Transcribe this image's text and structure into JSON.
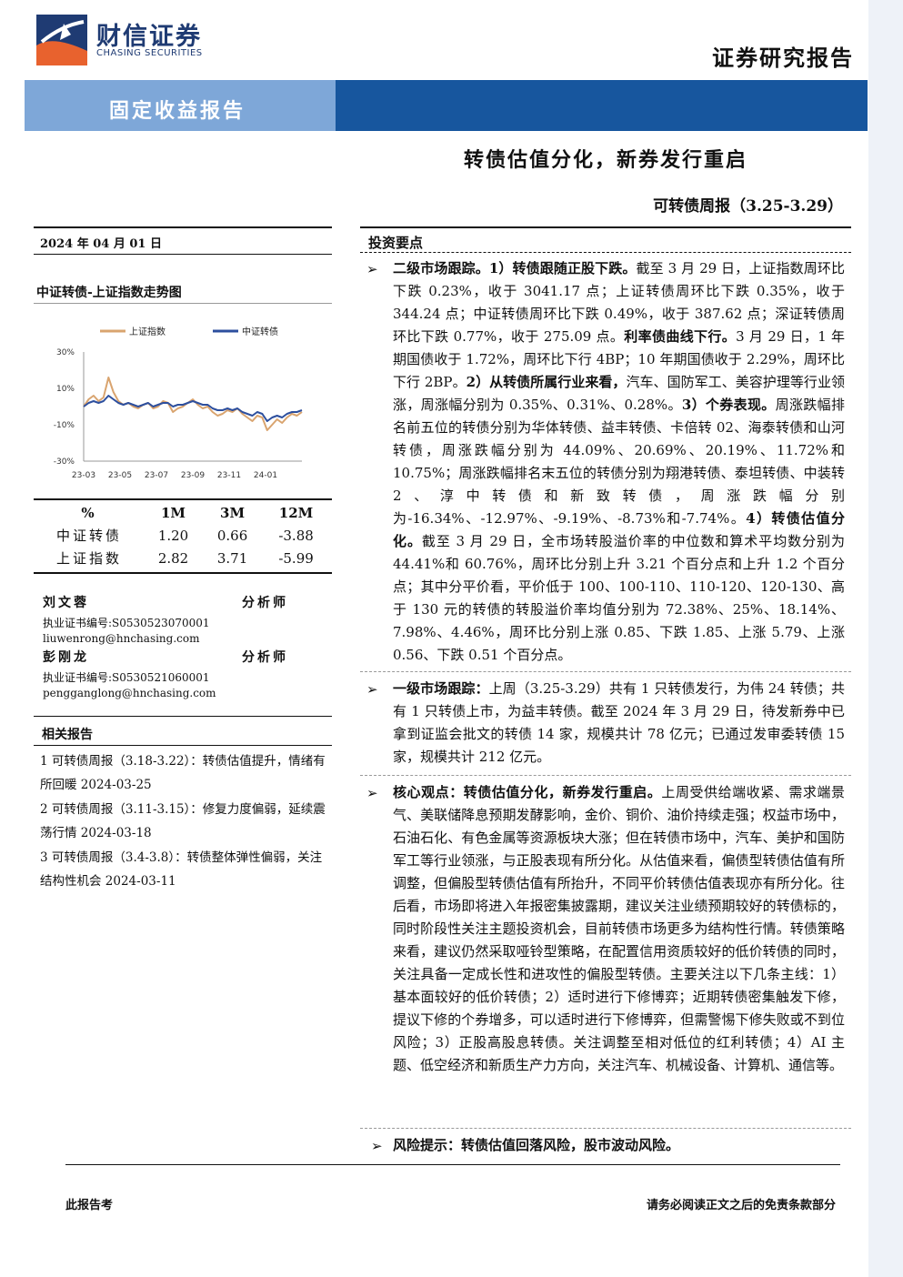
{
  "header": {
    "brand_cn": "财信证券",
    "brand_en": "CHASING SECURITIES",
    "report_type": "证券研究报告",
    "category": "固定收益报告",
    "title": "转债估值分化，新券发行重启",
    "subtitle": "可转债周报（3.25-3.29）"
  },
  "left": {
    "date": "2024 年 04 月 01 日",
    "chart_title": "中证转债-上证指数走势图",
    "performance": {
      "headers": [
        "%",
        "1M",
        "3M",
        "12M"
      ],
      "rows": [
        {
          "name": "中证转债",
          "m1": "1.20",
          "m3": "0.66",
          "m12": "-3.88"
        },
        {
          "name": "上证指数",
          "m1": "2.82",
          "m3": "3.71",
          "m12": "-5.99"
        }
      ]
    },
    "analysts": [
      {
        "name": "刘文蓉",
        "role": "分析师",
        "cert": "执业证书编号:S0530523070001",
        "email": "liuwenrong@hnchasing.com"
      },
      {
        "name": "彭刚龙",
        "role": "分析师",
        "cert": "执业证书编号:S0530521060001",
        "email": "pengganglong@hnchasing.com"
      }
    ],
    "related_title": "相关报告",
    "related": [
      "1 可转债周报（3.18-3.22）：转债估值提升，情绪有所回暖 2024-03-25",
      "2 可转债周报（3.11-3.15）：修复力度偏弱，延续震荡行情 2024-03-18",
      "3 可转债周报（3.4-3.8）：转债整体弹性偏弱，关注结构性机会 2024-03-11"
    ]
  },
  "chart_data": {
    "type": "line",
    "title": "中证转债-上证指数走势图",
    "x_ticks": [
      "23-03",
      "23-05",
      "23-07",
      "23-09",
      "23-11",
      "24-01"
    ],
    "y_ticks": [
      "30%",
      "10%",
      "-10%",
      "-30%"
    ],
    "ylim": [
      -30,
      30
    ],
    "legend": "top",
    "grid": false,
    "series": [
      {
        "name": "上证指数",
        "color": "#d9a46f",
        "values": [
          0,
          4,
          6,
          3,
          5,
          16,
          8,
          3,
          1,
          2,
          0,
          -1,
          1,
          2,
          -1,
          0,
          3,
          2,
          -3,
          -1,
          0,
          2,
          4,
          1,
          -1,
          0,
          -3,
          -5,
          -4,
          -2,
          -3,
          -1,
          -4,
          -6,
          -8,
          -5,
          -6,
          -13,
          -10,
          -7,
          -9,
          -6,
          -4,
          -5,
          -3
        ]
      },
      {
        "name": "中证转债",
        "color": "#2d4f9e",
        "values": [
          0,
          2,
          3,
          2,
          3,
          6,
          4,
          2,
          1,
          2,
          1,
          0,
          1,
          2,
          0,
          1,
          2,
          2,
          0,
          1,
          1,
          2,
          3,
          2,
          1,
          1,
          -1,
          -2,
          -2,
          -1,
          -2,
          -1,
          -3,
          -4,
          -5,
          -3,
          -4,
          -8,
          -6,
          -5,
          -6,
          -4,
          -3,
          -3,
          -2
        ]
      }
    ]
  },
  "right": {
    "section_title": "投资要点",
    "paragraphs": [
      {
        "runs": [
          {
            "b": true,
            "t": "二级市场跟踪。1）转债跟随正股下跌。"
          },
          {
            "b": false,
            "t": "截至 3 月 29 日，上证指数周环比下跌 0.23%，收于 3041.17 点；上证转债周环比下跌 0.35%，收于 344.24 点；中证转债周环比下跌 0.49%，收于 387.62 点；深证转债周环比下跌 0.77%，收于 275.09 点。"
          },
          {
            "b": true,
            "t": "利率债曲线下行。"
          },
          {
            "b": false,
            "t": "3 月 29 日，1 年期国债收于 1.72%，周环比下行 4BP；10 年期国债收于 2.29%，周环比下行 2BP。"
          },
          {
            "b": true,
            "t": "2）从转债所属行业来看，"
          },
          {
            "b": false,
            "t": "汽车、国防军工、美容护理等行业领涨，周涨幅分别为 0.35%、0.31%、0.28%。"
          },
          {
            "b": true,
            "t": "3）个券表现。"
          },
          {
            "b": false,
            "t": "周涨跌幅排名前五位的转债分别为华体转债、益丰转债、卡倍转 02、海泰转债和山河转债，周涨跌幅分别为 44.09%、20.69%、20.19%、11.72%和 10.75%；周涨跌幅排名末五位的转债分别为翔港转债、泰坦转债、中装转 2、淳中转债和新致转债，周涨跌幅分别为-16.34%、-12.97%、-9.19%、-8.73%和-7.74%。"
          },
          {
            "b": true,
            "t": "4）转债估值分化。"
          },
          {
            "b": false,
            "t": "截至 3 月 29 日，全市场转股溢价率的中位数和算术平均数分别为 44.41%和 60.76%，周环比分别上升 3.21 个百分点和上升 1.2 个百分点；其中分平价看，平价低于 100、100-110、110-120、120-130、高于 130 元的转债的转股溢价率均值分别为 72.38%、25%、18.14%、7.98%、4.46%，周环比分别上涨 0.85、下跌 1.85、上涨 5.79、上涨 0.56、下跌 0.51 个百分点。"
          }
        ]
      },
      {
        "runs": [
          {
            "b": true,
            "t": "一级市场跟踪："
          },
          {
            "b": false,
            "t": "上周（3.25-3.29）共有 1 只转债发行，为伟 24 转债；共有 1 只转债上市，为益丰转债。截至 2024 年 3 月 29 日，待发新券中已拿到证监会批文的转债 14 家，规模共计 78 亿元；已通过发审委转债 15 家，规模共计 212 亿元。"
          }
        ]
      },
      {
        "runs": [
          {
            "b": true,
            "t": "核心观点：转债估值分化，新券发行重启。"
          },
          {
            "b": false,
            "t": "上周受供给端收紧、需求端景气、美联储降息预期发酵影响，金价、铜价、油价持续走强；权益市场中，石油石化、有色金属等资源板块大涨；但在转债市场中，汽车、美护和国防军工等行业领涨，与正股表现有所分化。从估值来看，偏债型转债估值有所调整，但偏股型转债估值有所抬升，不同平价转债估值表现亦有所分化。往后看，市场即将进入年报密集披露期，建议关注业绩预期较好的转债标的，同时阶段性关注主题投资机会，目前转债市场更多为结构性行情。转债策略来看，建议仍然采取哑铃型策略，在配置信用资质较好的低价转债的同时，关注具备一定成长性和进攻性的偏股型转债。主要关注以下几条主线：1）基本面较好的低价转债；2）适时进行下修博弈；近期转债密集触发下修，提议下修的个券增多，可以适时进行下修博弈，但需警惕下修失败或不到位风险；3）正股高股息转债。关注调整至相对低位的红利转债；4）AI 主题、低空经济和新质生产力方向，关注汽车、机械设备、计算机、通信等。"
          }
        ]
      },
      {
        "runs": [
          {
            "b": true,
            "t": "风险提示：转债估值回落风险，股市波动风险。"
          }
        ]
      }
    ]
  },
  "footer": {
    "left": "此报告考",
    "right": "请务必阅读正文之后的免责条款部分"
  }
}
